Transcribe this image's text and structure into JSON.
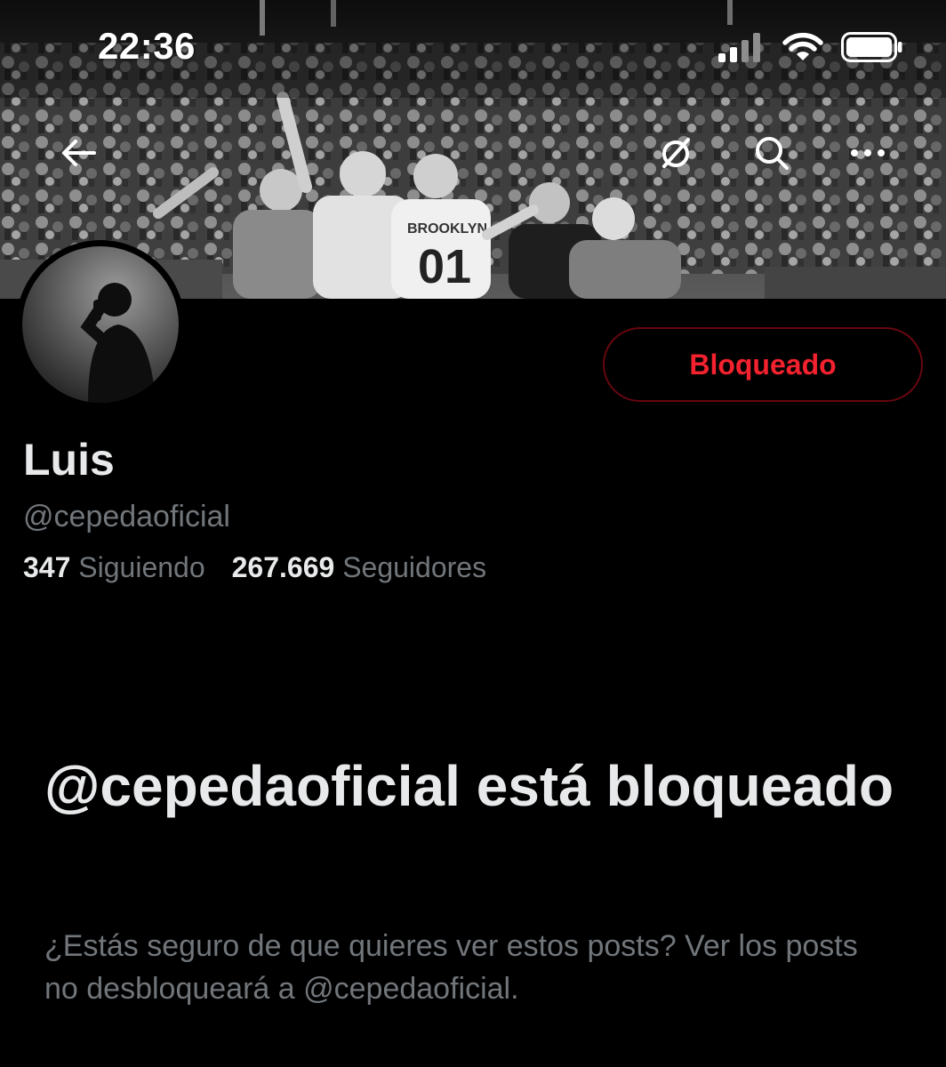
{
  "status_bar": {
    "time": "22:36",
    "icons": [
      "cellular-signal-icon",
      "wifi-icon",
      "battery-icon"
    ]
  },
  "nav": {
    "icons": [
      "back-arrow-icon",
      "grok-icon",
      "search-icon",
      "more-icon"
    ]
  },
  "profile": {
    "display_name": "Luis",
    "handle": "@cepedaoficial",
    "following_count": "347",
    "following_label": "Siguiendo",
    "followers_count": "267.669",
    "followers_label": "Seguidores",
    "blocked_button_label": "Bloqueado"
  },
  "blocked_notice": {
    "title": "@cepedaoficial está bloqueado",
    "description": "¿Estás seguro de que quieres ver estos posts? Ver los posts no desbloqueará a @cepedaoficial."
  },
  "colors": {
    "background": "#000000",
    "primary_text": "#e7e9ea",
    "secondary_text": "#71767b",
    "blocked_red": "#f4212e",
    "blocked_border": "#67070f"
  }
}
